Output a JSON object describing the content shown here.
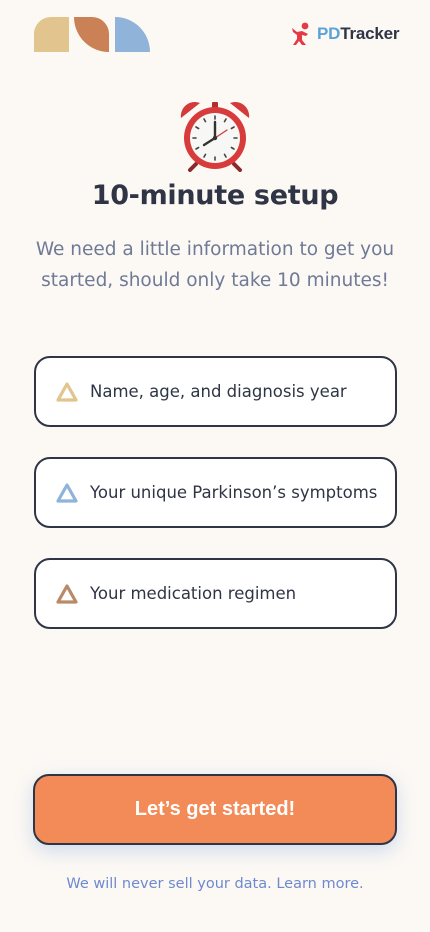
{
  "header": {
    "logo_prefix": "PD",
    "logo_suffix": "Tracker"
  },
  "hero": {
    "icon": "alarm-clock-icon",
    "title": "10-minute setup",
    "subtitle": "We need a little information to get you started, should only take 10 minutes!"
  },
  "steps": [
    {
      "label": "Name, age, and diagnosis year",
      "icon": "triangle-icon",
      "color": "#e2c48e"
    },
    {
      "label": "Your unique Parkinson’s symptoms",
      "icon": "triangle-icon",
      "color": "#8fb3d9"
    },
    {
      "label": "Your medication regimen",
      "icon": "triangle-icon",
      "color": "#b98a67"
    }
  ],
  "cta": {
    "label": "Let’s get started!"
  },
  "footer": {
    "text": "We will never sell your data.",
    "link": "Learn more."
  },
  "colors": {
    "background": "#fcf8f4",
    "accent": "#f28b58",
    "text": "#2f3545",
    "brand_tan": "#e2c48e",
    "brand_rust": "#c98155",
    "brand_blue": "#8fb3d9"
  }
}
